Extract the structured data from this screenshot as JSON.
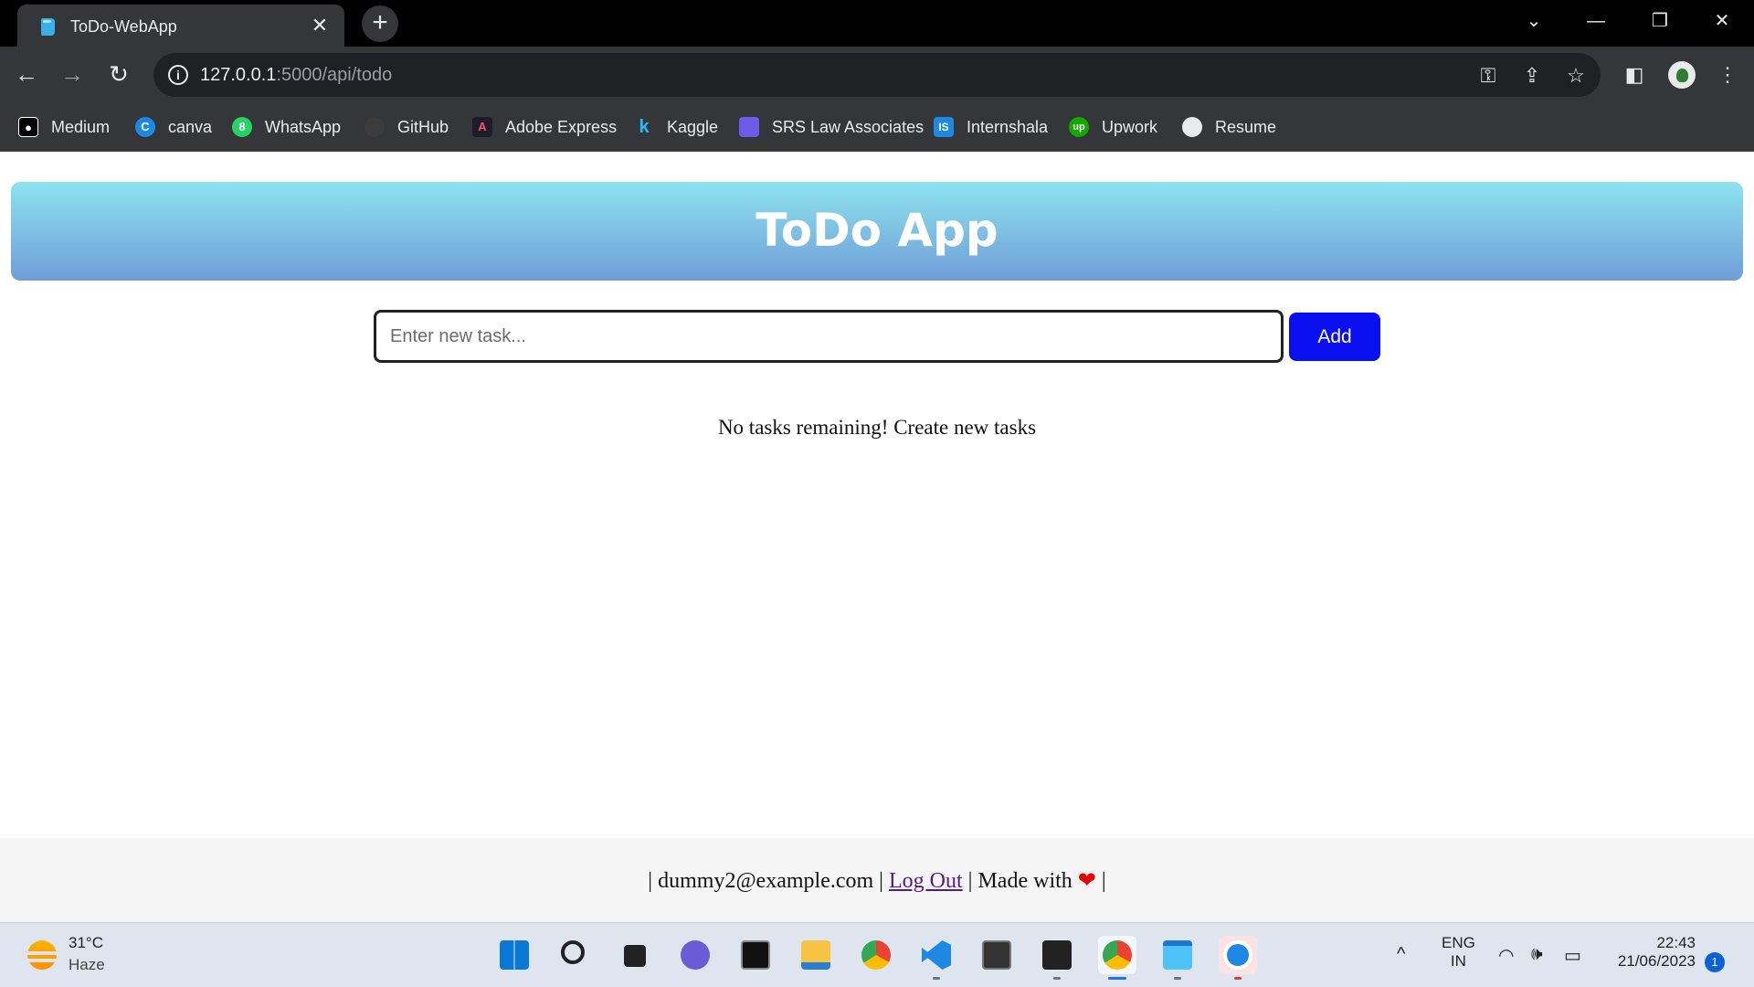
{
  "browser": {
    "tab_title": "ToDo-WebApp",
    "tab_close": "✕",
    "new_tab": "+",
    "url_host": "127.0.0.1",
    "url_path": ":5000/api/todo",
    "bookmarks": [
      {
        "label": "Medium",
        "icon": "medium-icon",
        "color": "#000000",
        "glyph": "M"
      },
      {
        "label": "canva",
        "icon": "canva-icon",
        "color": "#1e88e5",
        "glyph": "C"
      },
      {
        "label": "WhatsApp",
        "icon": "whatsapp-icon",
        "color": "#25d366",
        "glyph": "8"
      },
      {
        "label": "GitHub",
        "icon": "github-icon",
        "color": "#3c3c3c",
        "glyph": ""
      },
      {
        "label": "Adobe Express",
        "icon": "adobe-express-icon",
        "color": "#1c1c2b",
        "glyph": "A"
      },
      {
        "label": "Kaggle",
        "icon": "kaggle-icon",
        "color": "#35363a",
        "glyph": "k"
      },
      {
        "label": "SRS Law Associates",
        "icon": "calendar-icon",
        "color": "#6f5ce6",
        "glyph": ""
      },
      {
        "label": "Internshala",
        "icon": "internshala-icon",
        "color": "#1e88e5",
        "glyph": "IS"
      },
      {
        "label": "Upwork",
        "icon": "upwork-icon",
        "color": "#14a800",
        "glyph": "up"
      },
      {
        "label": "Resume",
        "icon": "globe-icon",
        "color": "#e8eaed",
        "glyph": ""
      }
    ]
  },
  "app": {
    "title": "ToDo App",
    "input_placeholder": "Enter new task...",
    "add_label": "Add",
    "empty_message": "No tasks remaining! Create new tasks"
  },
  "footer": {
    "sep_left": "|",
    "email": "dummy2@example.com",
    "sep_mid": "|",
    "logout_label": "Log Out",
    "made_with": "| Made with",
    "heart": "❤",
    "sep_right": "|"
  },
  "taskbar": {
    "temperature": "31°C",
    "condition": "Haze",
    "language_top": "ENG",
    "language_bottom": "IN",
    "time": "22:43",
    "date": "21/06/2023",
    "notification_count": "1"
  },
  "colors": {
    "header_gradient_top": "#8ee3ee",
    "header_gradient_bottom": "#6f9ed8",
    "add_button": "#0a0ff0",
    "heart": "#e60000"
  }
}
